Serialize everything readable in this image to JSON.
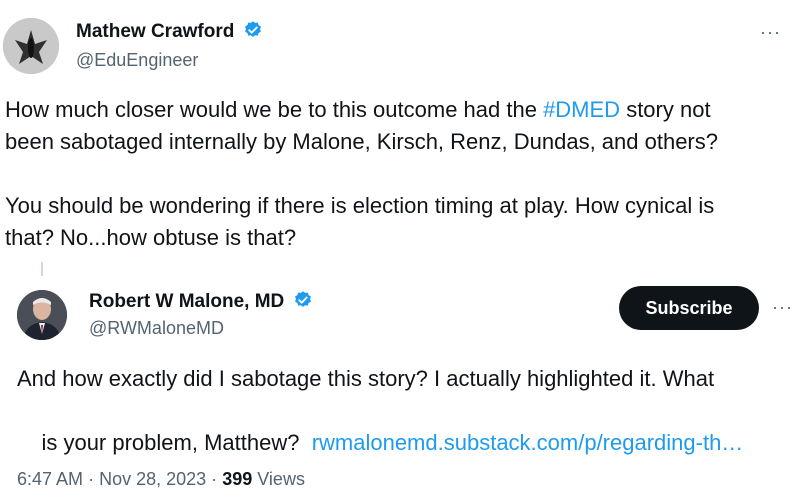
{
  "tweet": {
    "author_name": "Mathew Crawford",
    "author_handle": "@EduEngineer",
    "text_before_hashtag": "How much closer would we be to this outcome had the ",
    "hashtag": "#DMED",
    "text_line1_after": " story not",
    "text_line2": "been sabotaged internally by Malone, Kirsch, Renz, Dundas, and others?",
    "text_para2_line1": "You should be wondering if there is election timing at play. How cynical is",
    "text_para2_line2": "that? No...how obtuse is that?",
    "more_label": "···"
  },
  "reply": {
    "author_name": "Robert W Malone, MD",
    "author_handle": "@RWMaloneMD",
    "subscribe_label": "Subscribe",
    "more_label": "···",
    "text_line1": "And how exactly did I sabotage this story?  I actually highlighted it.  What",
    "text_line2_prefix": "is your problem, Matthew?  ",
    "link_text": "rwmalonemd.substack.com/p/regarding-th…",
    "time": "6:47 AM",
    "separator": "·",
    "date": "Nov 28, 2023",
    "views_count": "399",
    "views_label": "Views"
  },
  "colors": {
    "verified": "#1d9bf0",
    "link": "#1d9bf0",
    "subscribe_bg": "#0f1419"
  },
  "icons": {
    "verified": "verified-badge-icon",
    "more": "more-options-icon"
  }
}
